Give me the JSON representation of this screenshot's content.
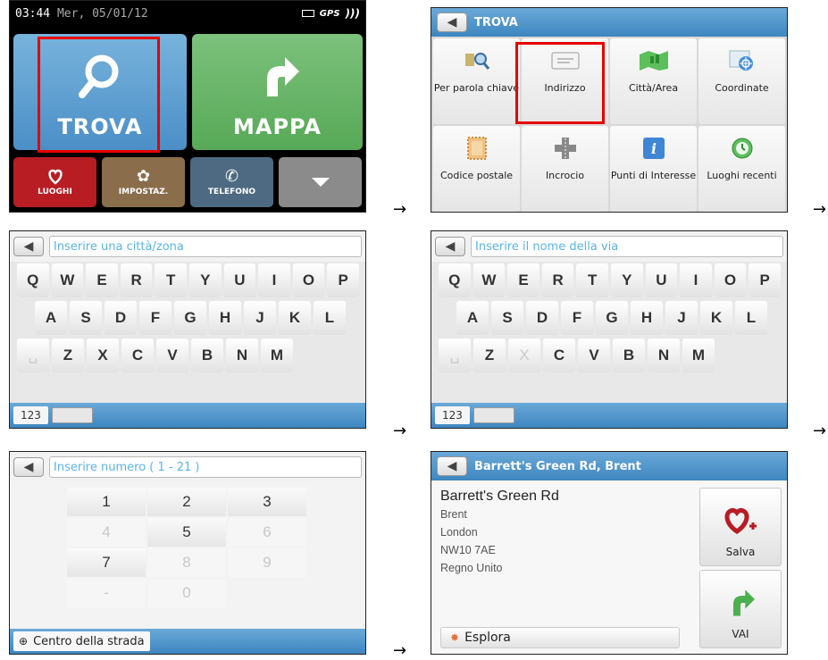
{
  "home": {
    "time": "03:44",
    "date": "Mer, 05/01/12",
    "gps_label": "GPS",
    "trova_label": "TROVA",
    "mappa_label": "MAPPA",
    "luoghi_label": "LUOGHI",
    "impostaz_label": "IMPOSTAZ.",
    "telefono_label": "TELEFONO",
    "colors": {
      "trova": "#5a9bd1",
      "mappa": "#66b266",
      "luoghi": "#b81d24",
      "impostaz": "#8a6e4b",
      "telefono": "#4e6a82",
      "more": "#8b8b8b",
      "highlight": "#e60000"
    }
  },
  "menu": {
    "title": "TROVA",
    "tiles": [
      {
        "label": "Per parola chiave",
        "icon": "keyword-search-icon"
      },
      {
        "label": "Indirizzo",
        "icon": "address-card-icon"
      },
      {
        "label": "Città/Area",
        "icon": "city-map-icon"
      },
      {
        "label": "Coordinate",
        "icon": "coordinate-icon"
      },
      {
        "label": "Codice postale",
        "icon": "postal-stamp-icon"
      },
      {
        "label": "Incrocio",
        "icon": "crossroad-icon"
      },
      {
        "label": "Punti di Interesse",
        "icon": "info-icon"
      },
      {
        "label": "Luoghi recenti",
        "icon": "clock-icon"
      }
    ]
  },
  "kb1": {
    "placeholder": "Inserire una città/zona",
    "row1": [
      "Q",
      "W",
      "E",
      "R",
      "T",
      "Y",
      "U",
      "I",
      "O",
      "P"
    ],
    "row2": [
      "A",
      "S",
      "D",
      "F",
      "G",
      "H",
      "J",
      "K",
      "L"
    ],
    "row3": [
      "Z",
      "X",
      "C",
      "V",
      "B",
      "N",
      "M"
    ],
    "mode_label": "123"
  },
  "kb2": {
    "placeholder": "Inserire il nome della via",
    "row1": [
      "Q",
      "W",
      "E",
      "R",
      "T",
      "Y",
      "U",
      "I",
      "O",
      "P"
    ],
    "row2": [
      "A",
      "S",
      "D",
      "F",
      "G",
      "H",
      "J",
      "K",
      "L"
    ],
    "row3": [
      "Z",
      "X",
      "C",
      "V",
      "B",
      "N",
      "M"
    ],
    "mode_label": "123"
  },
  "numpad": {
    "placeholder": "Inserire numero ( 1 - 21 )",
    "keys": [
      "1",
      "2",
      "3",
      "4",
      "5",
      "6",
      "7",
      "8",
      "9",
      "-",
      "0"
    ],
    "centro_label": "Centro della strada"
  },
  "result": {
    "title": "Barrett's Green Rd, Brent",
    "street": "Barrett's Green Rd",
    "district": "Brent",
    "city": "London",
    "postcode": "NW10 7AE",
    "country": "Regno Unito",
    "salva_label": "Salva",
    "vai_label": "VAI",
    "esplora_label": "Esplora"
  },
  "arrow_glyph": "→"
}
